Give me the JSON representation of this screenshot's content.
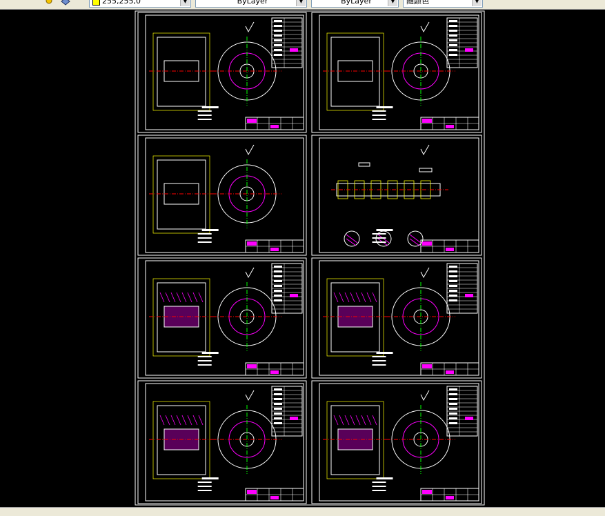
{
  "toolbar": {
    "color_combo": "255,255,0",
    "linetype_combo": "ByLayer",
    "lineweight_combo": "ByLayer",
    "plotstyle_combo": "随颜色"
  },
  "drawing": {
    "sheet_count": 8,
    "colors": {
      "background": "#000000",
      "frame": "#ffffff",
      "part": "#ffffff",
      "dimension": "#ffff00",
      "hatch": "#ff00ff",
      "centerline": "#ff0000",
      "aux": "#00ff00"
    }
  }
}
